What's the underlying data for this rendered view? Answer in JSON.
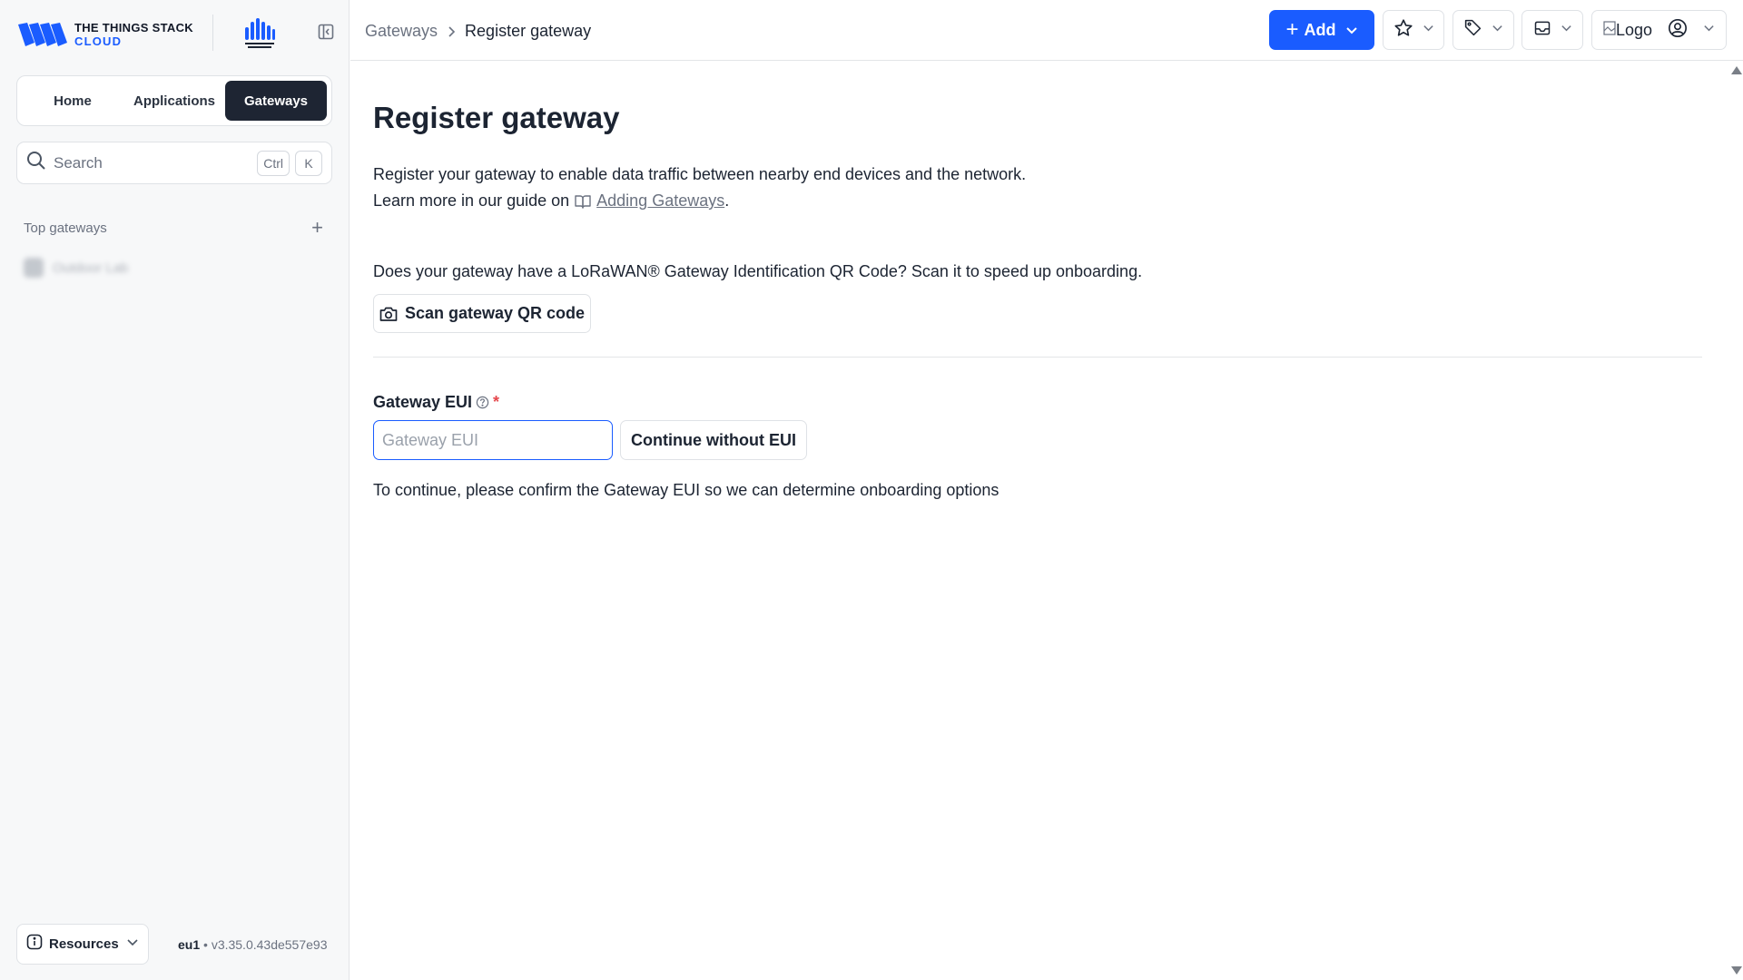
{
  "brand": {
    "line1": "THE THINGS STACK",
    "line2": "CLOUD",
    "accent": "#1a5cff"
  },
  "nav": {
    "tabs": [
      {
        "label": "Home"
      },
      {
        "label": "Applications"
      },
      {
        "label": "Gateways"
      }
    ],
    "active": "Gateways"
  },
  "search": {
    "placeholder": "Search",
    "shortcut_1": "Ctrl",
    "shortcut_2": "K"
  },
  "sidebar": {
    "section_title": "Top gateways",
    "gateway_item": "Outdoor Lab"
  },
  "footer": {
    "resources_label": "Resources",
    "cluster": "eu1",
    "version": "v3.35.0.43de557e93"
  },
  "header": {
    "breadcrumb_parent": "Gateways",
    "breadcrumb_current": "Register gateway",
    "add_label": "Add",
    "profile_logo_alt": "Logo"
  },
  "main": {
    "title": "Register gateway",
    "intro_line1": "Register your gateway to enable data traffic between nearby end devices and the network.",
    "intro_line2_prefix": "Learn more in our guide on",
    "intro_link": "Adding Gateways",
    "intro_suffix": ".",
    "qr_prompt": "Does your gateway have a LoRaWAN® Gateway Identification QR Code? Scan it to speed up onboarding.",
    "qr_button": "Scan gateway QR code",
    "eui_label": "Gateway EUI",
    "eui_required": "*",
    "eui_placeholder": "Gateway EUI",
    "eui_value": "",
    "continue_button": "Continue without EUI",
    "hint": "To continue, please confirm the Gateway EUI so we can determine onboarding options"
  },
  "icons": {
    "collapse": "sidebar-collapse-icon",
    "search": "search-icon",
    "add": "plus-icon",
    "star": "star-icon",
    "tag": "tag-icon",
    "inbox": "inbox-icon",
    "user": "user-circle-icon",
    "camera": "camera-icon",
    "book": "book-icon",
    "help": "help-circle-icon",
    "info": "info-icon"
  },
  "colors": {
    "primary": "#1a5cff",
    "dark": "#1e2533",
    "required": "#e5484d"
  }
}
